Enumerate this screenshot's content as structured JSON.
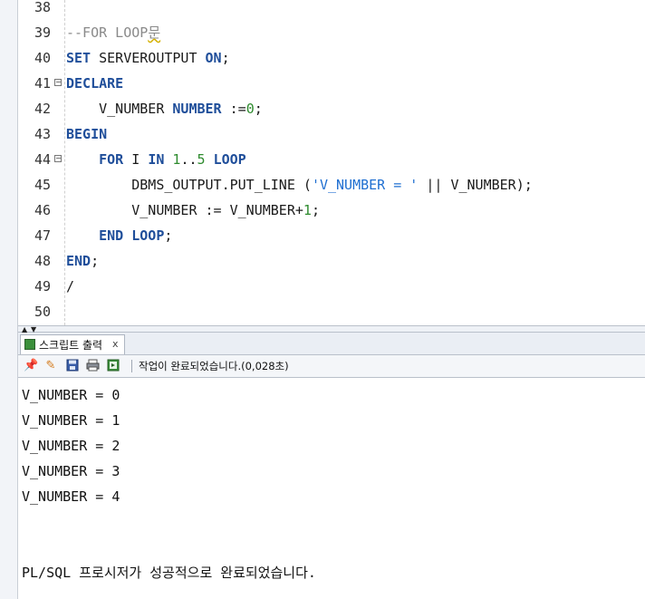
{
  "editor": {
    "lines": [
      {
        "n": "38",
        "fold": false,
        "parts": []
      },
      {
        "n": "39",
        "fold": false,
        "parts": [
          {
            "t": "--FOR LOOP",
            "c": "cmt"
          },
          {
            "t": "문",
            "c": "cmt squig"
          }
        ]
      },
      {
        "n": "40",
        "fold": false,
        "parts": [
          {
            "t": "SET",
            "c": "kw"
          },
          {
            "t": " SERVEROUTPUT ",
            "c": ""
          },
          {
            "t": "ON",
            "c": "kw"
          },
          {
            "t": ";",
            "c": ""
          }
        ]
      },
      {
        "n": "41",
        "fold": true,
        "parts": [
          {
            "t": "DECLARE",
            "c": "kw"
          }
        ]
      },
      {
        "n": "42",
        "fold": false,
        "parts": [
          {
            "t": "    V_NUMBER ",
            "c": ""
          },
          {
            "t": "NUMBER",
            "c": "kw"
          },
          {
            "t": " :=",
            "c": ""
          },
          {
            "t": "0",
            "c": "num"
          },
          {
            "t": ";",
            "c": ""
          }
        ]
      },
      {
        "n": "43",
        "fold": false,
        "parts": [
          {
            "t": "BEGIN",
            "c": "kw"
          }
        ]
      },
      {
        "n": "44",
        "fold": true,
        "parts": [
          {
            "t": "    ",
            "c": ""
          },
          {
            "t": "FOR",
            "c": "kw"
          },
          {
            "t": " I ",
            "c": ""
          },
          {
            "t": "IN",
            "c": "kw"
          },
          {
            "t": " ",
            "c": ""
          },
          {
            "t": "1",
            "c": "num"
          },
          {
            "t": "..",
            "c": ""
          },
          {
            "t": "5",
            "c": "num"
          },
          {
            "t": " ",
            "c": ""
          },
          {
            "t": "LOOP",
            "c": "kw"
          }
        ]
      },
      {
        "n": "45",
        "fold": false,
        "parts": [
          {
            "t": "        DBMS_OUTPUT.PUT_LINE (",
            "c": ""
          },
          {
            "t": "'V_NUMBER = '",
            "c": "str"
          },
          {
            "t": " || V_NUMBER);",
            "c": ""
          }
        ]
      },
      {
        "n": "46",
        "fold": false,
        "parts": [
          {
            "t": "        V_NUMBER := V_NUMBER+",
            "c": ""
          },
          {
            "t": "1",
            "c": "num"
          },
          {
            "t": ";",
            "c": ""
          }
        ]
      },
      {
        "n": "47",
        "fold": false,
        "parts": [
          {
            "t": "    ",
            "c": ""
          },
          {
            "t": "END",
            "c": "kw"
          },
          {
            "t": " ",
            "c": ""
          },
          {
            "t": "LOOP",
            "c": "kw"
          },
          {
            "t": ";",
            "c": ""
          }
        ]
      },
      {
        "n": "48",
        "fold": false,
        "parts": [
          {
            "t": "END",
            "c": "kw"
          },
          {
            "t": ";",
            "c": ""
          }
        ]
      },
      {
        "n": "49",
        "fold": false,
        "parts": [
          {
            "t": "/",
            "c": ""
          }
        ]
      },
      {
        "n": "50",
        "fold": false,
        "parts": []
      }
    ]
  },
  "output_panel": {
    "tab_label": "스크립트 출력",
    "tab_close": "x",
    "status": "작업이 완료되었습니다.(0,028초)",
    "lines": [
      "V_NUMBER = 0",
      "V_NUMBER = 1",
      "V_NUMBER = 2",
      "V_NUMBER = 3",
      "V_NUMBER = 4",
      "",
      "",
      "PL/SQL 프로시저가 성공적으로 완료되었습니다."
    ]
  },
  "icons": {
    "splitter": [
      "arrow-up-icon",
      "arrow-down-icon"
    ],
    "toolbar": [
      "pin-icon",
      "eraser-icon",
      "save-icon",
      "print-icon",
      "export-icon"
    ]
  },
  "colors": {
    "keyword": "#1f4e9a",
    "number": "#2e8b2e",
    "string": "#1f6fd1",
    "comment": "#8a8a8a"
  }
}
